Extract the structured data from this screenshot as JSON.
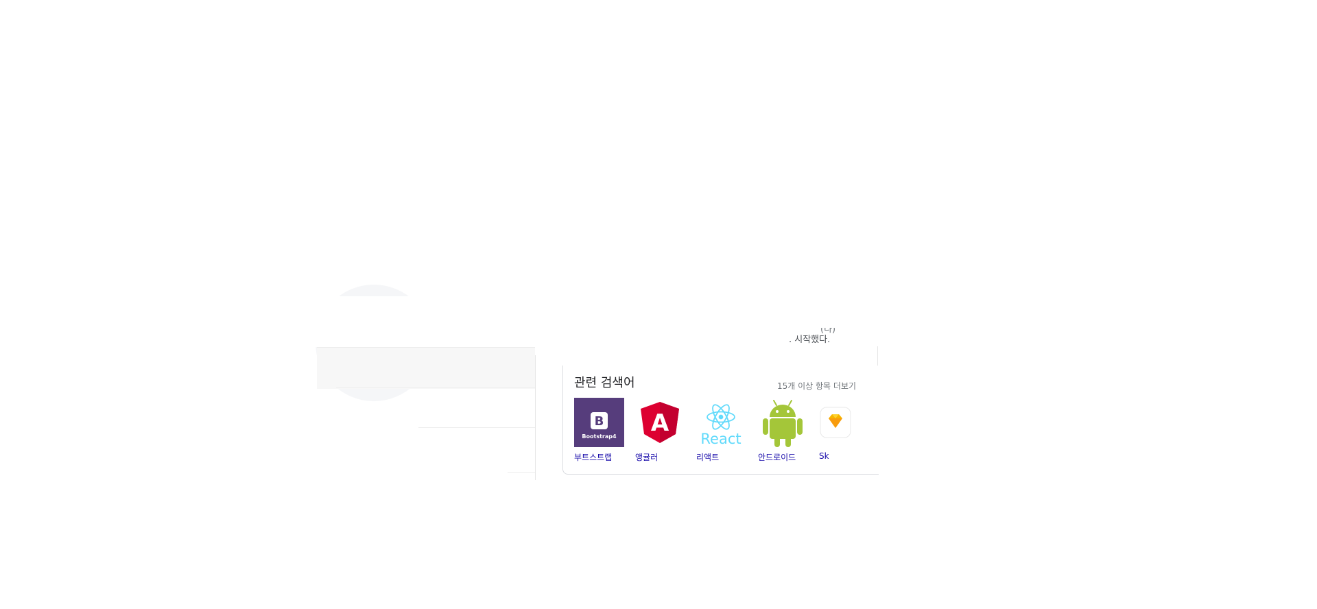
{
  "snippet": {
    "fragment_top": "(다)",
    "fragment_text": ". 시작했다."
  },
  "related_searches": {
    "title": "관련 검색어",
    "more_link": "15개 이상 항목 더보기",
    "items": [
      {
        "label": "부트스트랩",
        "icon": "bootstrap-logo",
        "logo_text": "B",
        "logo_sub": "Bootstrap4",
        "color": "#563d7c"
      },
      {
        "label": "앵귤러",
        "icon": "angular-logo",
        "logo_text": "A",
        "color": "#dd0031"
      },
      {
        "label": "리액트",
        "icon": "react-logo",
        "logo_text": "React",
        "color": "#61dafb"
      },
      {
        "label": "안드로이드",
        "icon": "android-logo",
        "color": "#a4c639"
      },
      {
        "label": "Sk",
        "icon": "sketch-logo",
        "color": "#f7b500"
      }
    ]
  }
}
